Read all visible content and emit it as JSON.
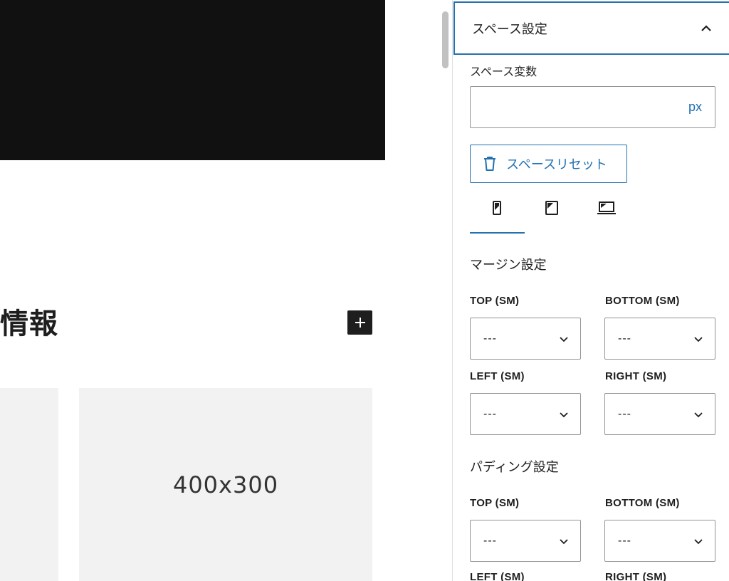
{
  "canvas": {
    "section_heading": "情報",
    "placeholder_text": "400x300",
    "add_block_icon": "plus-icon"
  },
  "panel": {
    "title": "スペース設定",
    "toggle_icon": "chevron-up-icon",
    "space_variable_label": "スペース変数",
    "space_variable_value": "",
    "space_variable_unit": "px",
    "reset_label": "スペースリセット",
    "reset_icon": "trash-icon",
    "device_tabs": [
      {
        "name": "mobile",
        "icon": "mobile-icon",
        "active": true
      },
      {
        "name": "tablet",
        "icon": "tablet-icon",
        "active": false
      },
      {
        "name": "desktop",
        "icon": "laptop-icon",
        "active": false
      }
    ],
    "margin": {
      "title": "マージン設定",
      "top_label": "TOP (SM)",
      "top_value": "---",
      "bottom_label": "BOTTOM (SM)",
      "bottom_value": "---",
      "left_label": "LEFT (SM)",
      "left_value": "---",
      "right_label": "RIGHT (SM)",
      "right_value": "---"
    },
    "padding": {
      "title": "パディング設定",
      "top_label": "TOP (SM)",
      "top_value": "---",
      "bottom_label": "BOTTOM (SM)",
      "bottom_value": "---",
      "left_label": "LEFT (SM)",
      "right_label": "RIGHT (SM)"
    }
  },
  "colors": {
    "accent": "#2271b1",
    "hero": "#111111",
    "placeholder_bg": "#f2f2f2"
  }
}
